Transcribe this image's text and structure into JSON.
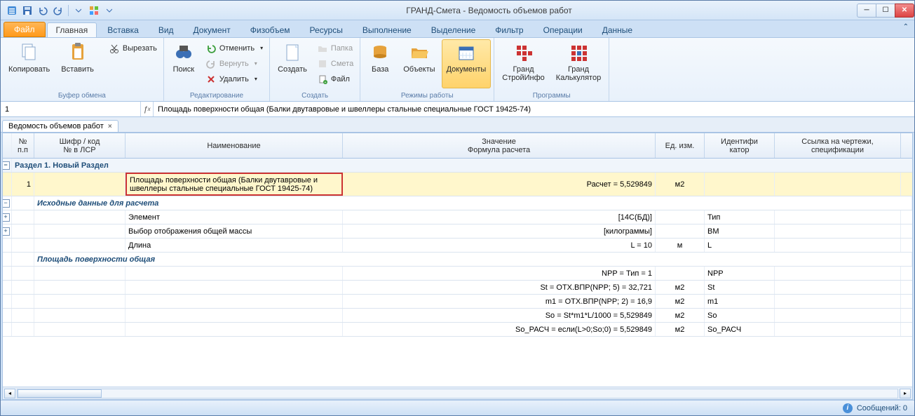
{
  "app_title": "ГРАНД-Смета - Ведомость объемов работ",
  "ribbon": {
    "file_tab": "Файл",
    "tabs": [
      "Главная",
      "Вставка",
      "Вид",
      "Документ",
      "Физобъем",
      "Ресурсы",
      "Выполнение",
      "Выделение",
      "Фильтр",
      "Операции",
      "Данные"
    ],
    "active_tab_index": 0,
    "groups": {
      "clipboard": {
        "label": "Буфер обмена",
        "copy": "Копировать",
        "paste": "Вставить",
        "cut": "Вырезать"
      },
      "edit": {
        "label": "Редактирование",
        "find": "Поиск",
        "undo": "Отменить",
        "redo": "Вернуть",
        "delete": "Удалить"
      },
      "create": {
        "label": "Создать",
        "create": "Создать",
        "folder": "Папка",
        "estimate": "Смета",
        "file": "Файл"
      },
      "modes": {
        "label": "Режимы работы",
        "base": "База",
        "objects": "Объекты",
        "docs": "Документы"
      },
      "programs": {
        "label": "Программы",
        "grandstroy": "Гранд\nСтройИнфо",
        "grandcalc": "Гранд\nКалькулятор"
      }
    }
  },
  "formula": {
    "cell_ref": "1",
    "value": "Площадь поверхности общая (Балки двутавровые и швеллеры стальные специальные ГОСТ 19425-74)"
  },
  "doc_tab": "Ведомость объемов работ",
  "grid": {
    "headers": {
      "num": "№\nп.п",
      "code": "Шифр / код\n№ в ЛСР",
      "name": "Наименование",
      "value": "Значение\nФормула расчета",
      "unit": "Ед. изм.",
      "id": "Идентифи\nкатор",
      "ref": "Ссылка на чертежи,\nспецификации"
    },
    "section_title": "Раздел 1. Новый Раздел",
    "row_main": {
      "num": "1",
      "name": "Площадь поверхности общая (Балки двутавровые и швеллеры стальные специальные ГОСТ 19425-74)",
      "value": "Расчет = 5,529849",
      "unit": "м2"
    },
    "sub1_title": "Исходные данные для расчета",
    "r_elem": {
      "name": "Элемент",
      "value": "[14С(БД)]",
      "id": "Тип"
    },
    "r_mass": {
      "name": "Выбор отображения общей массы",
      "value": "[килограммы]",
      "id": "BM"
    },
    "r_len": {
      "name": "Длина",
      "value": "L = 10",
      "unit": "м",
      "id": "L"
    },
    "sub2_title": "Площадь поверхности общая",
    "r_npp": {
      "value": "NPP = Тип = 1",
      "id": "NPP"
    },
    "r_st": {
      "value": "St = ОТХ.ВПР(NPP; 5) = 32,721",
      "unit": "м2",
      "id": "St"
    },
    "r_m1": {
      "value": "m1 = ОТХ.ВПР(NPP; 2) = 16,9",
      "unit": "м2",
      "id": "m1"
    },
    "r_so": {
      "value": "So = St*m1*L/1000 = 5,529849",
      "unit": "м2",
      "id": "So"
    },
    "r_sor": {
      "value": "So_РАСЧ = если(L>0;So;0) = 5,529849",
      "unit": "м2",
      "id": "So_РАСЧ"
    }
  },
  "status": {
    "messages_label": "Сообщений:",
    "messages_count": "0"
  }
}
